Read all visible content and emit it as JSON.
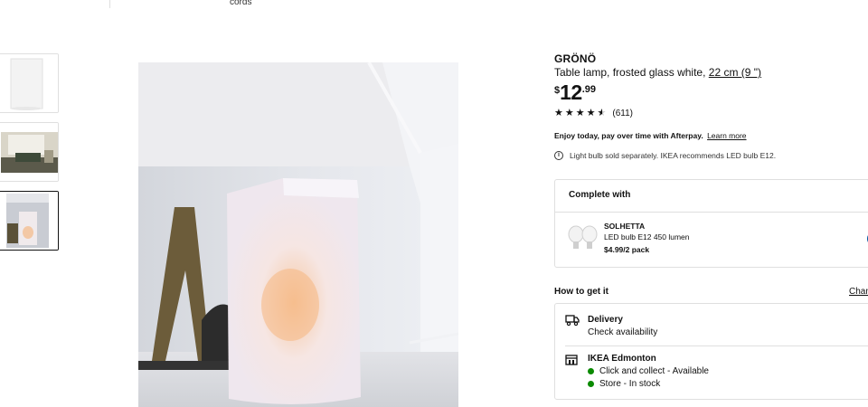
{
  "top": {
    "cords_text": "cords"
  },
  "gallery": {
    "thumbnails": [
      {
        "name": "product-front"
      },
      {
        "name": "room-scene"
      },
      {
        "name": "lit-lamp",
        "selected": true
      }
    ]
  },
  "product": {
    "brand": "GRÖNÖ",
    "description": "Table lamp, frosted glass white,",
    "size_link": "22 cm (9 \")",
    "price": {
      "currency": "$",
      "integer": "12",
      "decimal": ".99"
    },
    "rating": {
      "stars": 4.5,
      "count": "(611)"
    },
    "afterpay_text": "Enjoy today, pay over time with Afterpay.",
    "learn_more": "Learn more",
    "bulb_note": "Light bulb sold separately. IKEA recommends LED bulb E12.",
    "info_icon": "i"
  },
  "complete_with": {
    "title": "Complete with",
    "item": {
      "name": "SOLHETTA",
      "description": "LED bulb E12 450 lumen",
      "price": "$4.99/2 pack"
    }
  },
  "how_to_get": {
    "title": "How to get it",
    "change_label": "Chan",
    "delivery_title": "Delivery",
    "delivery_sub": "Check availability",
    "store_title": "IKEA Edmonton",
    "availability": [
      "Click and collect - Available",
      "Store - In stock"
    ]
  },
  "colors": {
    "ikea_blue": "#0058a3",
    "available_green": "#0a8a00",
    "border": "#dfdfdf"
  }
}
